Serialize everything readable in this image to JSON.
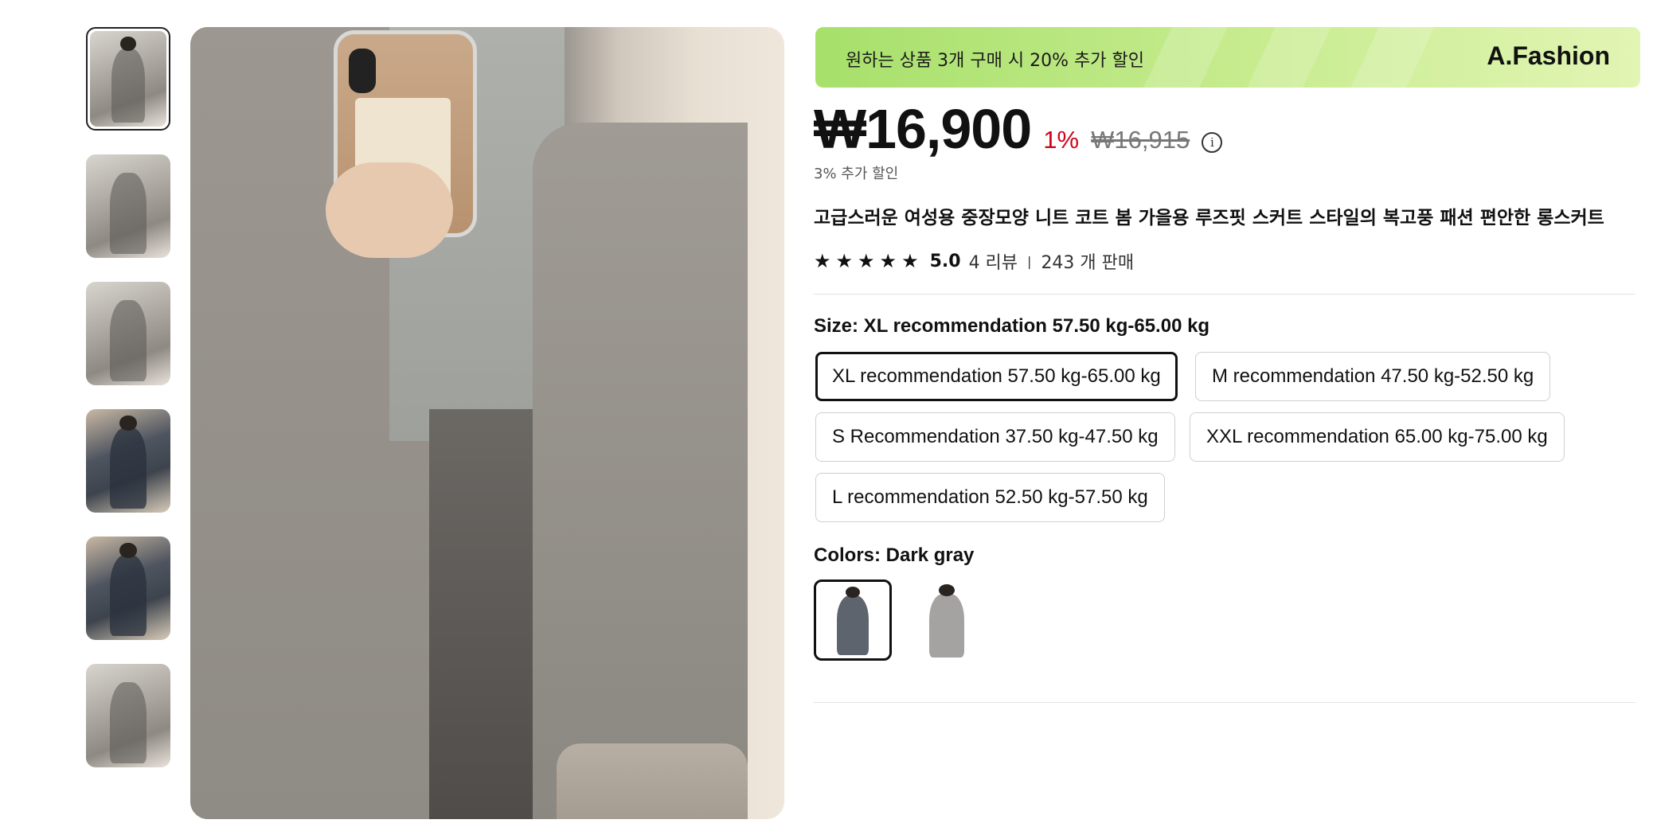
{
  "banner": {
    "promo": "원하는 상품 3개 구매 시 20% 추가 할인",
    "brand": "A.Fashion"
  },
  "price": {
    "current": "₩16,900",
    "discount": "1%",
    "original": "₩16,915",
    "extra_discount": "3% 추가 할인"
  },
  "product": {
    "title": "고급스러운 여성용 중장모양 니트 코트 봄 가을용 루즈핏 스커트 스타일의 복고풍 패션 편안한 롱스커트",
    "rating": "5.0",
    "stars": 5,
    "reviews": "4 리뷰",
    "separator": "|",
    "sold": "243 개 판매"
  },
  "size": {
    "label": "Size: XL recommendation 57.50 kg-65.00 kg",
    "options": [
      "XL recommendation 57.50 kg-65.00 kg",
      "M recommendation 47.50 kg-52.50 kg",
      "S Recommendation 37.50 kg-47.50 kg",
      "XXL recommendation 65.00 kg-75.00 kg",
      "L recommendation 52.50 kg-57.50 kg"
    ],
    "selected_index": 0
  },
  "colors": {
    "label": "Colors: Dark gray",
    "options": [
      "Dark gray",
      "Gray"
    ],
    "selected_index": 0
  },
  "gallery": {
    "thumbnail_count": 6,
    "selected_index": 0
  },
  "theme": {
    "accent_red": "#d0021b",
    "banner_green": "#a7e06b",
    "text": "#111111"
  }
}
